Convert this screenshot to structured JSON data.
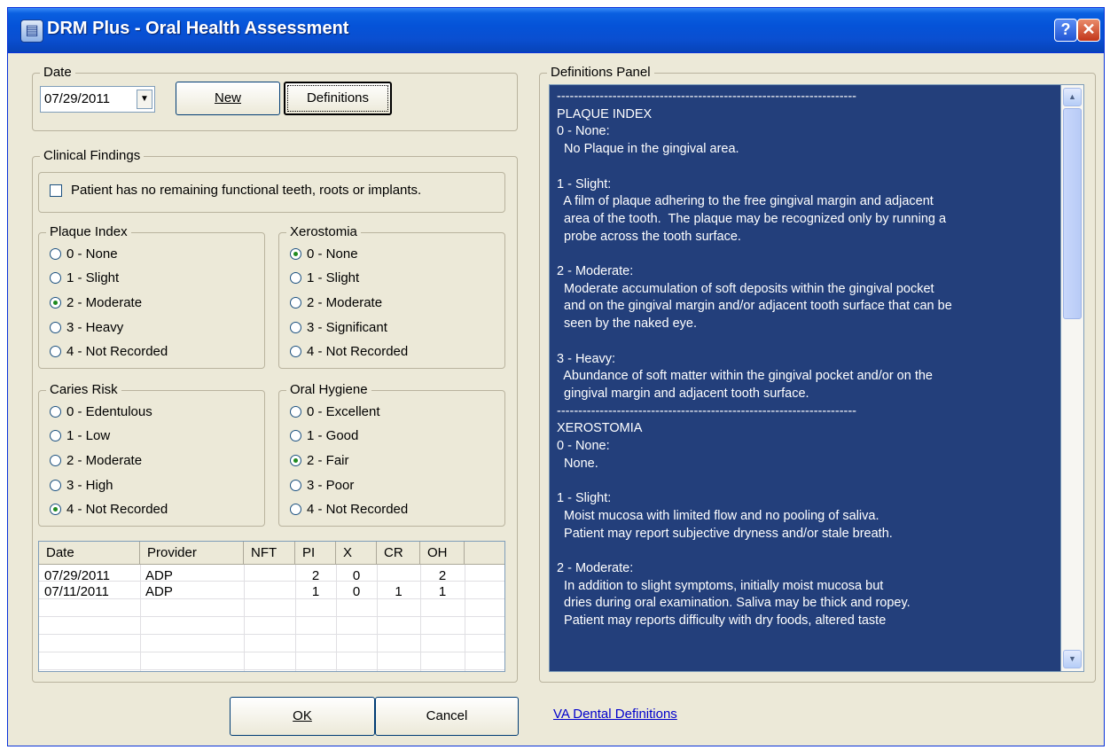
{
  "window": {
    "title": "DRM Plus - Oral Health Assessment",
    "icon": "app-document-icon",
    "help_label": "?",
    "close_label": "✕"
  },
  "date_group": {
    "legend": "Date",
    "date_value": "07/29/2011",
    "dropdown_glyph": "▼",
    "new_label": "New",
    "definitions_label": "Definitions"
  },
  "clinical": {
    "legend": "Clinical Findings",
    "no_teeth_label": "Patient has no remaining functional teeth, roots or implants.",
    "no_teeth_checked": false,
    "plaque": {
      "legend": "Plaque Index",
      "options": [
        "0 - None",
        "1 - Slight",
        "2 - Moderate",
        "3 - Heavy",
        "4 - Not Recorded"
      ],
      "selected": 2
    },
    "xerostomia": {
      "legend": "Xerostomia",
      "options": [
        "0 - None",
        "1 - Slight",
        "2 - Moderate",
        "3 - Significant",
        "4 - Not Recorded"
      ],
      "selected": 0
    },
    "caries": {
      "legend": "Caries Risk",
      "options": [
        "0 - Edentulous",
        "1 - Low",
        "2 - Moderate",
        "3 - High",
        "4 - Not Recorded"
      ],
      "selected": 4
    },
    "hygiene": {
      "legend": "Oral Hygiene",
      "options": [
        "0 - Excellent",
        "1 - Good",
        "2 - Fair",
        "3 - Poor",
        "4 - Not Recorded"
      ],
      "selected": 2
    }
  },
  "history": {
    "columns": [
      "Date",
      "Provider",
      "NFT",
      "PI",
      "X",
      "CR",
      "OH"
    ],
    "rows": [
      [
        "07/29/2011",
        "ADP",
        "",
        "2",
        "0",
        "",
        "2"
      ],
      [
        "07/11/2011",
        "ADP",
        "",
        "1",
        "0",
        "1",
        "1"
      ]
    ]
  },
  "definitions": {
    "legend": "Definitions Panel",
    "text": "----------------------------------------------------------------------\nPLAQUE INDEX\n0 - None:\n  No Plaque in the gingival area.\n\n1 - Slight:\n  A film of plaque adhering to the free gingival margin and adjacent\n  area of the tooth.  The plaque may be recognized only by running a\n  probe across the tooth surface.\n\n2 - Moderate:\n  Moderate accumulation of soft deposits within the gingival pocket\n  and on the gingival margin and/or adjacent tooth surface that can be\n  seen by the naked eye.\n\n3 - Heavy:\n  Abundance of soft matter within the gingival pocket and/or on the\n  gingival margin and adjacent tooth surface.\n----------------------------------------------------------------------\nXEROSTOMIA\n0 - None:\n  None.\n\n1 - Slight:\n  Moist mucosa with limited flow and no pooling of saliva.\n  Patient may report subjective dryness and/or stale breath.\n\n2 - Moderate:\n  In addition to slight symptoms, initially moist mucosa but\n  dries during oral examination. Saliva may be thick and ropey.\n  Patient may reports difficulty with dry foods, altered taste",
    "scroll_up": "▲",
    "scroll_down": "▼"
  },
  "footer": {
    "ok_label": "OK",
    "cancel_label": "Cancel",
    "link_label": "VA Dental Definitions"
  }
}
